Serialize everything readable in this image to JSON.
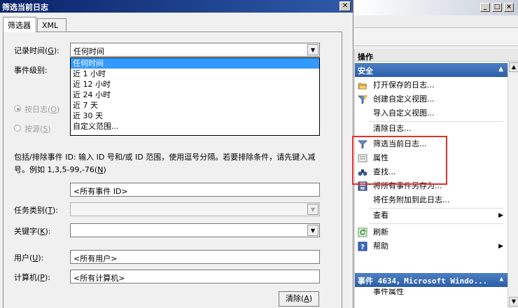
{
  "dialog": {
    "title": "筛选当前日志",
    "close_glyph": "✕",
    "tabs": [
      "筛选器",
      "XML"
    ],
    "logged": {
      "label": "记录时间(",
      "key": "G",
      "suffix": "):",
      "value": "任何时间"
    },
    "time_options": [
      "任何时间",
      "近 1 小时",
      "近 12 小时",
      "近 24 小时",
      "近 7 天",
      "近 30 天",
      "自定义范围..."
    ],
    "event_level": {
      "label": "事件级别:"
    },
    "by_log": {
      "label": "按日志(",
      "key": "O",
      "suffix": ")"
    },
    "by_source": {
      "label": "按源(",
      "key": "S",
      "suffix": ")"
    },
    "include_text": "包括/排除事件 ID: 输入 ID 号和/或 ID 范围，使用逗号分隔。若要排除条件，请先键入减",
    "include_text2": "号。例如 1,3,5-99,-76(",
    "include_key": "N",
    "include_suffix": ")",
    "event_id_value": "<所有事件 ID>",
    "task_category": {
      "label": "任务类别(",
      "key": "T",
      "suffix": "):"
    },
    "keywords": {
      "label": "关键字(",
      "key": "K",
      "suffix": "):"
    },
    "user": {
      "label": "用户(",
      "key": "U",
      "suffix": "):",
      "value": "<所有用户>"
    },
    "computer": {
      "label": "计算机(",
      "key": "P",
      "suffix": "):",
      "value": "<所有计算机>"
    },
    "clear": {
      "label": "清除(",
      "key": "A",
      "suffix": ")"
    }
  },
  "mmc": {
    "window_buttons": [
      "_",
      "□",
      "×"
    ],
    "ops_header": "操作",
    "section": "安全",
    "actions": [
      {
        "label": "打开保存的日志...",
        "icon": "folder-open-icon"
      },
      {
        "label": "创建自定义视图...",
        "icon": "filter-create-icon"
      },
      {
        "label": "导入自定义视图...",
        "icon": ""
      },
      {
        "label": "清除日志...",
        "icon": ""
      },
      {
        "label": "筛选当前日志...",
        "icon": "filter-icon"
      },
      {
        "label": "属性",
        "icon": "properties-icon"
      },
      {
        "label": "查找...",
        "icon": "binoculars-icon"
      },
      {
        "label": "将所有事件另存为...",
        "icon": "save-icon"
      },
      {
        "label": "将任务附加到此日志...",
        "icon": ""
      },
      {
        "label": "查看",
        "icon": ""
      },
      {
        "label": "刷新",
        "icon": "refresh-icon"
      },
      {
        "label": "帮助",
        "icon": "help-icon"
      }
    ],
    "event_section": "事件 4634，Microsoft Windo...",
    "event_next_item": "事件属性",
    "caret_up": "▲",
    "arrow_right": "▶"
  },
  "colors": {
    "highlight": "#3399ff",
    "section_blue": "#2b5ea8",
    "annotation_red": "#e03030"
  }
}
